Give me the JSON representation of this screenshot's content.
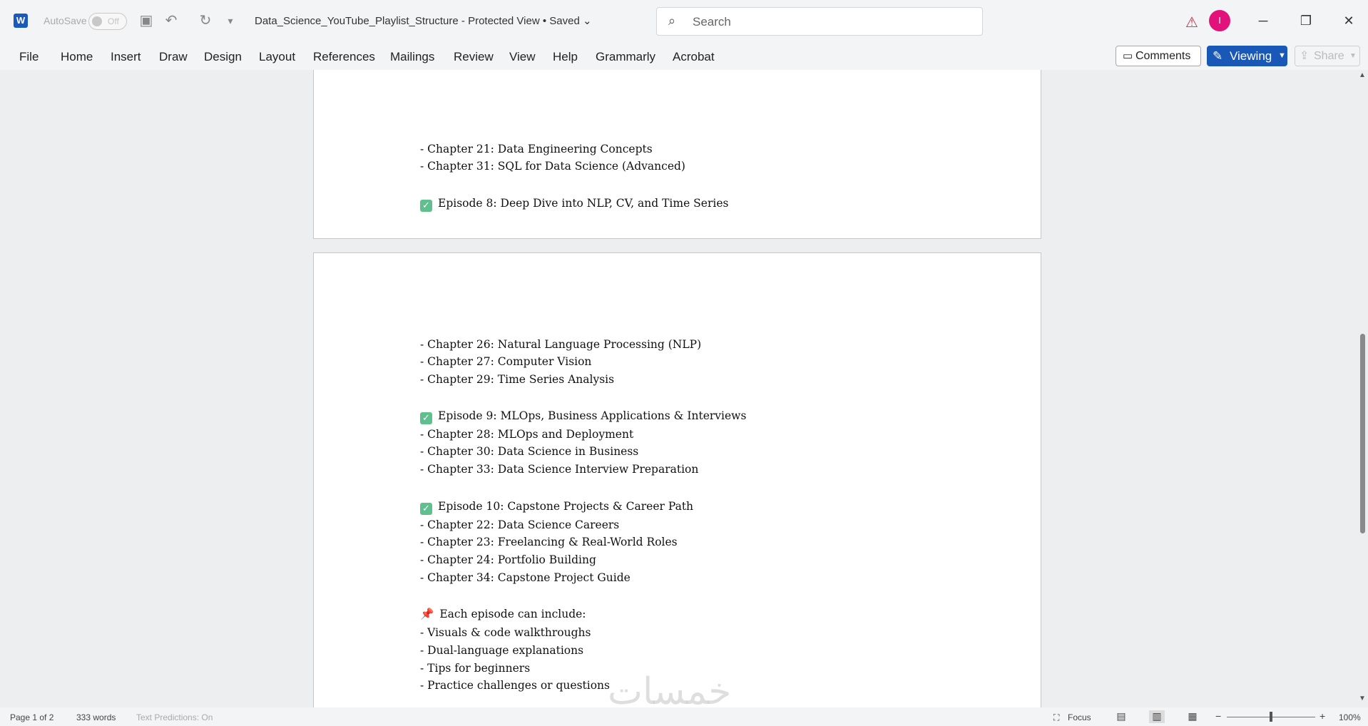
{
  "titlebar": {
    "autosave_label": "AutoSave",
    "autosave_state": "Off",
    "doc_title": "Data_Science_YouTube_Playlist_Structure  -  Protected View • Saved",
    "title_chevron": "⌄",
    "search_placeholder": "Search",
    "avatar_initial": "I",
    "minimize": "─",
    "restore": "❐",
    "close": "✕"
  },
  "ribbon": {
    "tabs": [
      "File",
      "Home",
      "Insert",
      "Draw",
      "Design",
      "Layout",
      "References",
      "Mailings",
      "Review",
      "View",
      "Help",
      "Grammarly",
      "Acrobat"
    ],
    "comments_label": "Comments",
    "viewing_label": "Viewing",
    "share_label": "Share"
  },
  "document": {
    "page1_lines": [
      "- Chapter 21: Data Engineering Concepts",
      "- Chapter 31: SQL for Data Science (Advanced)",
      "",
      "Episode 8: Deep Dive into NLP, CV, and Time Series"
    ],
    "page2_lines": [
      "- Chapter 26: Natural Language Processing (NLP)",
      "- Chapter 27: Computer Vision",
      "- Chapter 29: Time Series Analysis",
      "",
      "Episode 9: MLOps, Business Applications & Interviews",
      "- Chapter 28: MLOps and Deployment",
      "- Chapter 30: Data Science in Business",
      "- Chapter 33: Data Science Interview Preparation",
      "",
      "Episode 10: Capstone Projects & Career Path",
      "- Chapter 22: Data Science Careers",
      "- Chapter 23: Freelancing & Real-World Roles",
      "- Chapter 24: Portfolio Building",
      "- Chapter 34: Capstone Project Guide",
      "",
      "Each episode can include:",
      "- Visuals & code walkthroughs",
      "- Dual-language explanations",
      "- Tips for beginners",
      "- Practice challenges or questions"
    ]
  },
  "watermark": "خمسات",
  "statusbar": {
    "page": "Page 1 of 2",
    "words": "333 words",
    "predictions": "Text Predictions: On",
    "focus": "Focus",
    "zoom_minus": "−",
    "zoom_plus": "+",
    "zoom_level": "100%"
  },
  "colors": {
    "accent": "#1a58b8",
    "avatar": "#e3127b",
    "checkmark": "#5fbf8f"
  },
  "icons": {
    "word": "word-app-icon",
    "save": "save-icon",
    "undo": "undo-icon",
    "redo": "redo-icon",
    "customize": "customize-qat-icon",
    "search": "search-icon",
    "warning": "warning-icon",
    "checkbox": "check-box-icon",
    "pin": "pushpin-icon"
  }
}
